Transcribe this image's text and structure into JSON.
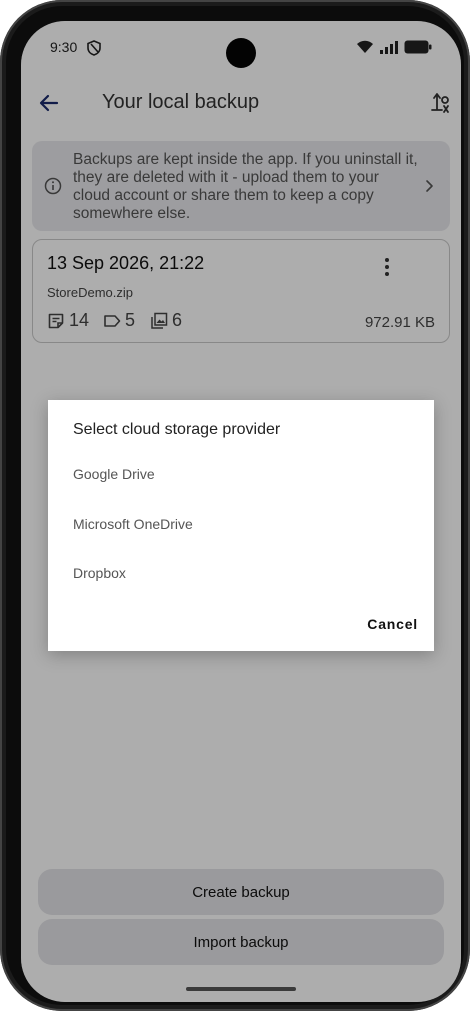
{
  "status_bar": {
    "time": "9:30",
    "icons": [
      "shield-icon",
      "wifi-icon",
      "signal-icon",
      "battery-icon"
    ]
  },
  "app_bar": {
    "title": "Your local backup",
    "icons": [
      "back-arrow-icon",
      "sort-icon"
    ]
  },
  "info_banner": {
    "text": "Backups are kept inside the app. If you uninstall it, they are deleted with it - upload them to your cloud account or share them to keep a copy somewhere else.",
    "icons": [
      "info-icon",
      "chevron-right-icon"
    ]
  },
  "backup_card": {
    "date": "13 Sep 2026, 21:22",
    "filename": "StoreDemo.zip",
    "stats": [
      {
        "icon": "note-icon",
        "value": "14"
      },
      {
        "icon": "label-tag-icon",
        "value": "5"
      },
      {
        "icon": "gallery-stack-icon",
        "value": "6"
      }
    ],
    "size": "972.91 KB"
  },
  "dialog": {
    "title": "Select cloud storage provider",
    "options": [
      "Google Drive",
      "Microsoft OneDrive",
      "Dropbox"
    ],
    "cancel": "Cancel"
  },
  "buttons": {
    "create": "Create backup",
    "import": "Import backup"
  },
  "colors": {
    "scrim": "#000000",
    "banner_bg": "#e8e8ec",
    "button_bg": "#e4e4e8"
  }
}
